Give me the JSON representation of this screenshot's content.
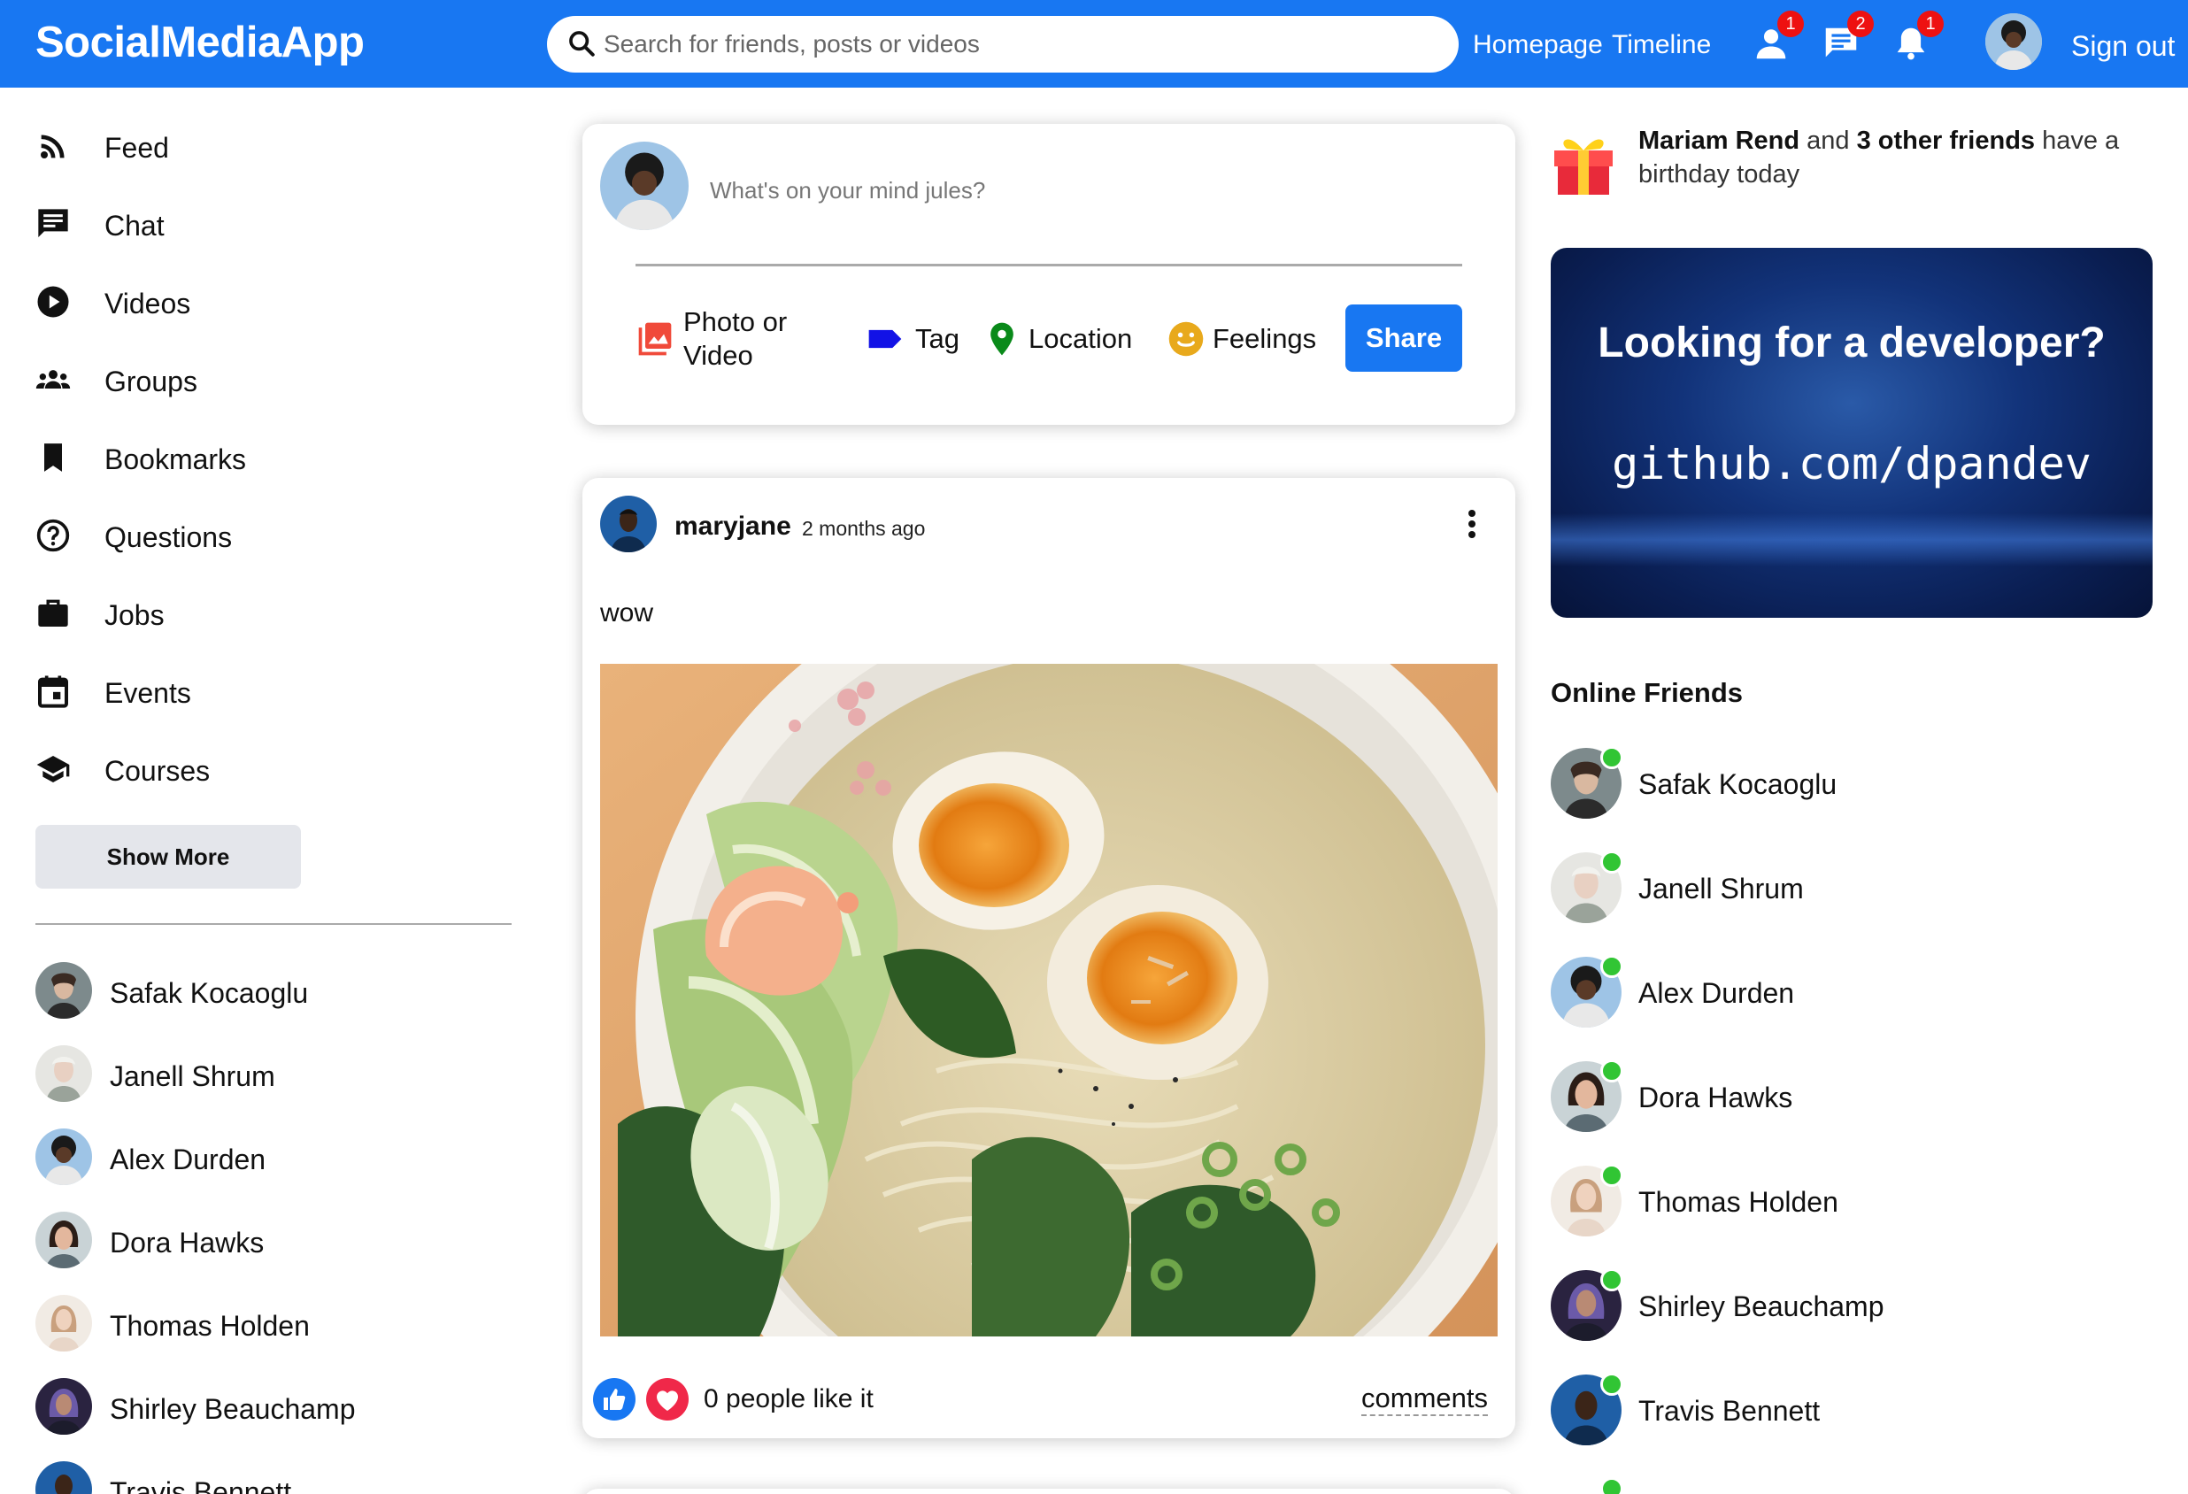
{
  "app": {
    "title": "SocialMediaApp"
  },
  "search": {
    "placeholder": "Search for friends, posts or videos"
  },
  "topnav": {
    "links": [
      "Homepage",
      "Timeline"
    ],
    "badges": {
      "friends": "1",
      "messages": "2",
      "notifications": "1"
    },
    "signout": "Sign out"
  },
  "sidebar": {
    "items": [
      {
        "label": "Feed",
        "icon": "rss-icon"
      },
      {
        "label": "Chat",
        "icon": "chat-icon"
      },
      {
        "label": "Videos",
        "icon": "play-circle-icon"
      },
      {
        "label": "Groups",
        "icon": "group-icon"
      },
      {
        "label": "Bookmarks",
        "icon": "bookmark-icon"
      },
      {
        "label": "Questions",
        "icon": "help-circle-icon"
      },
      {
        "label": "Jobs",
        "icon": "briefcase-icon"
      },
      {
        "label": "Events",
        "icon": "calendar-icon"
      },
      {
        "label": "Courses",
        "icon": "school-icon"
      }
    ],
    "show_more": "Show More",
    "friends": [
      "Safak Kocaoglu",
      "Janell Shrum",
      "Alex Durden",
      "Dora Hawks",
      "Thomas Holden",
      "Shirley Beauchamp",
      "Travis Bennett"
    ]
  },
  "share": {
    "placeholder": "What's on your mind jules?",
    "options": {
      "photo_line1": "Photo or",
      "photo_line2": "Video",
      "tag": "Tag",
      "location": "Location",
      "feelings": "Feelings"
    },
    "button": "Share"
  },
  "post": {
    "username": "maryjane",
    "time": "2 months ago",
    "text": "wow",
    "likes": "0 people like it",
    "comments": "comments"
  },
  "rightbar": {
    "birthday": {
      "name": "Mariam Rend",
      "mid": " and ",
      "others": "3 other friends",
      "tail": " have a birthday today"
    },
    "ad": {
      "title": "Looking for a developer?",
      "url": "github.com/dpandev"
    },
    "online_title": "Online Friends",
    "online_friends": [
      "Safak Kocaoglu",
      "Janell Shrum",
      "Alex Durden",
      "Dora Hawks",
      "Thomas Holden",
      "Shirley Beauchamp",
      "Travis Bennett"
    ]
  },
  "colors": {
    "brand": "#1877f2",
    "online": "#31c534",
    "badge": "#ee1111"
  }
}
